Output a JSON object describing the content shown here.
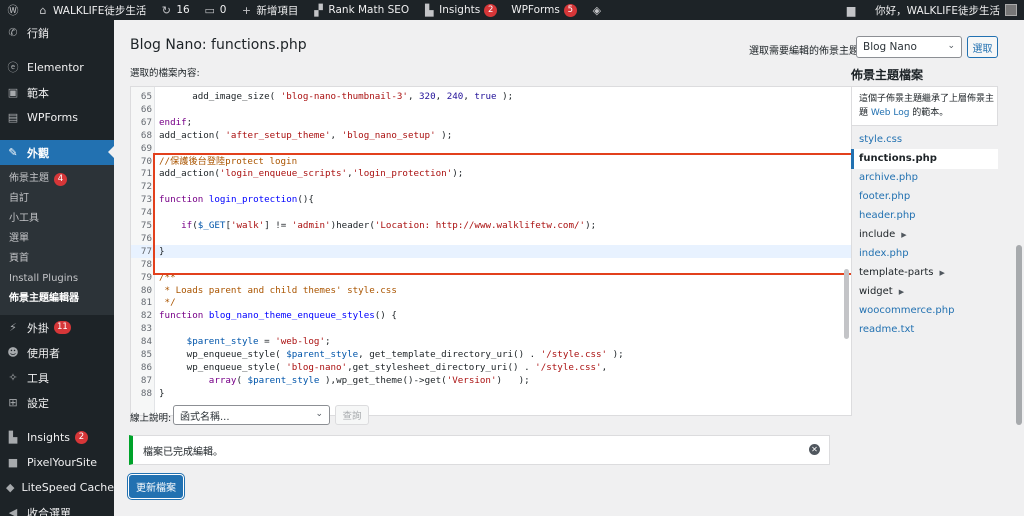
{
  "admin_bar": {
    "site_name": "WALKLIFE徒步生活",
    "updates_count": "16",
    "comments_count": "0",
    "new_label": "新增項目",
    "rank_math_label": "Rank Math SEO",
    "insights_label": "Insights",
    "insights_count": "2",
    "wpforms_label": "WPForms",
    "wpforms_count": "5",
    "greeting": "你好，WALKLIFE徒步生活"
  },
  "sidebar": {
    "items_top": [
      {
        "label": "行銷",
        "icon": "megaphone-icon"
      },
      {
        "label": "Elementor",
        "icon": "elementor-icon"
      },
      {
        "label": "範本",
        "icon": "folder-icon"
      },
      {
        "label": "WPForms",
        "icon": "wpforms-icon"
      }
    ],
    "active": {
      "label": "外觀",
      "icon": "appearance-brush-icon"
    },
    "submenu": [
      {
        "label": "佈景主題",
        "badge": "4"
      },
      {
        "label": "自訂"
      },
      {
        "label": "小工具"
      },
      {
        "label": "選單"
      },
      {
        "label": "頁首"
      },
      {
        "label": "Install Plugins"
      },
      {
        "label": "佈景主題編輯器"
      }
    ],
    "items_bottom": [
      {
        "label": "外掛",
        "icon": "plugin-icon",
        "badge": "11"
      },
      {
        "label": "使用者",
        "icon": "users-icon"
      },
      {
        "label": "工具",
        "icon": "wrench-icon"
      },
      {
        "label": "設定",
        "icon": "settings-icon"
      }
    ],
    "items_plugins": [
      {
        "label": "Insights",
        "icon": "insights-icon",
        "badge": "2"
      },
      {
        "label": "PixelYourSite",
        "icon": "pixel-icon"
      },
      {
        "label": "LiteSpeed Cache",
        "icon": "litespeed-icon"
      },
      {
        "label": "收合選單",
        "icon": "collapse-icon"
      }
    ]
  },
  "header": {
    "title": "Blog Nano: functions.php",
    "theme_select_label": "選取需要編輯的佈景主題:",
    "theme_select_value": "Blog Nano",
    "select_button": "選取"
  },
  "editor": {
    "label": "選取的檔案內容:",
    "lines": [
      {
        "n": "65",
        "parts": [
          [
            "",
            "      add_image_size( "
          ],
          [
            "str",
            "'blog-nano-thumbnail-3'"
          ],
          [
            "",
            ", "
          ],
          [
            "num",
            "320"
          ],
          [
            "",
            ", "
          ],
          [
            "num",
            "240"
          ],
          [
            "",
            ", "
          ],
          [
            "cn",
            "true"
          ],
          [
            "",
            " );"
          ]
        ]
      },
      {
        "n": "66",
        "parts": []
      },
      {
        "n": "67",
        "parts": [
          [
            "kw",
            "endif"
          ],
          [
            "",
            ";"
          ]
        ]
      },
      {
        "n": "68",
        "parts": [
          [
            "",
            "add_action( "
          ],
          [
            "str",
            "'after_setup_theme'"
          ],
          [
            "",
            ", "
          ],
          [
            "str",
            "'blog_nano_setup'"
          ],
          [
            "",
            " );"
          ]
        ]
      },
      {
        "n": "69",
        "parts": []
      },
      {
        "n": "70",
        "parts": [
          [
            "com",
            "//保護後台登陸protect login"
          ]
        ]
      },
      {
        "n": "71",
        "parts": [
          [
            "",
            "add_action("
          ],
          [
            "str",
            "'login_enqueue_scripts'"
          ],
          [
            "",
            ","
          ],
          [
            "str",
            "'login_protection'"
          ],
          [
            "",
            ");"
          ]
        ]
      },
      {
        "n": "72",
        "parts": []
      },
      {
        "n": "73",
        "parts": [
          [
            "kw",
            "function"
          ],
          [
            "",
            " "
          ],
          [
            "def",
            "login_protection"
          ],
          [
            "",
            "(){"
          ]
        ]
      },
      {
        "n": "74",
        "parts": []
      },
      {
        "n": "75",
        "parts": [
          [
            "",
            "    "
          ],
          [
            "kw",
            "if"
          ],
          [
            "",
            "("
          ],
          [
            "var",
            "$_GET"
          ],
          [
            "",
            "["
          ],
          [
            "str",
            "'walk'"
          ],
          [
            "",
            "] != "
          ],
          [
            "str",
            "'admin'"
          ],
          [
            "",
            ")header("
          ],
          [
            "str",
            "'Location: http://www.walklifetw.com/'"
          ],
          [
            "",
            ");"
          ]
        ]
      },
      {
        "n": "76",
        "parts": []
      },
      {
        "n": "77",
        "parts": [
          [
            "",
            "}"
          ]
        ]
      },
      {
        "n": "78",
        "parts": []
      },
      {
        "n": "79",
        "parts": [
          [
            "com",
            "/**"
          ]
        ]
      },
      {
        "n": "80",
        "parts": [
          [
            "com",
            " * Loads parent and child themes' style.css"
          ]
        ]
      },
      {
        "n": "81",
        "parts": [
          [
            "com",
            " */"
          ]
        ]
      },
      {
        "n": "82",
        "parts": [
          [
            "kw",
            "function"
          ],
          [
            "",
            " "
          ],
          [
            "def",
            "blog_nano_theme_enqueue_styles"
          ],
          [
            "",
            "() {"
          ]
        ]
      },
      {
        "n": "83",
        "parts": []
      },
      {
        "n": "84",
        "parts": [
          [
            "",
            "     "
          ],
          [
            "var",
            "$parent_style"
          ],
          [
            "",
            " = "
          ],
          [
            "str",
            "'web-log'"
          ],
          [
            "",
            ";"
          ]
        ]
      },
      {
        "n": "85",
        "parts": [
          [
            "",
            "     wp_enqueue_style( "
          ],
          [
            "var",
            "$parent_style"
          ],
          [
            "",
            ", get_template_directory_uri() . "
          ],
          [
            "str",
            "'/style.css'"
          ],
          [
            "",
            " );"
          ]
        ]
      },
      {
        "n": "86",
        "parts": [
          [
            "",
            "     wp_enqueue_style( "
          ],
          [
            "str",
            "'blog-nano'"
          ],
          [
            "",
            ",get_stylesheet_directory_uri() . "
          ],
          [
            "str",
            "'/style.css'"
          ],
          [
            "",
            ","
          ]
        ]
      },
      {
        "n": "87",
        "parts": [
          [
            "",
            "         "
          ],
          [
            "kw",
            "array"
          ],
          [
            "",
            "( "
          ],
          [
            "var",
            "$parent_style"
          ],
          [
            "",
            " ),wp_get_theme()->get("
          ],
          [
            "str",
            "'Version'"
          ],
          [
            "",
            ")   );"
          ]
        ]
      },
      {
        "n": "88",
        "parts": [
          [
            "",
            "}"
          ]
        ]
      }
    ]
  },
  "docs": {
    "label": "線上說明:",
    "select_value": "函式名稱...",
    "lookup_button": "查詢"
  },
  "notice": {
    "text": "檔案已完成編輯。"
  },
  "update_button": "更新檔案",
  "theme_files": {
    "heading": "佈景主題檔案",
    "desc_prefix": "這個子佈景主題繼承了上層佈景主題 ",
    "desc_link": "Web Log",
    "desc_suffix": " 的範本。",
    "files": [
      {
        "label": "style.css",
        "type": "file"
      },
      {
        "label": "functions.php",
        "type": "current"
      },
      {
        "label": "archive.php",
        "type": "file"
      },
      {
        "label": "footer.php",
        "type": "file"
      },
      {
        "label": "header.php",
        "type": "file"
      },
      {
        "label": "include",
        "type": "folder"
      },
      {
        "label": "index.php",
        "type": "file"
      },
      {
        "label": "template-parts",
        "type": "folder"
      },
      {
        "label": "widget",
        "type": "folder"
      },
      {
        "label": "woocommerce.php",
        "type": "file"
      },
      {
        "label": "readme.txt",
        "type": "file"
      }
    ]
  }
}
